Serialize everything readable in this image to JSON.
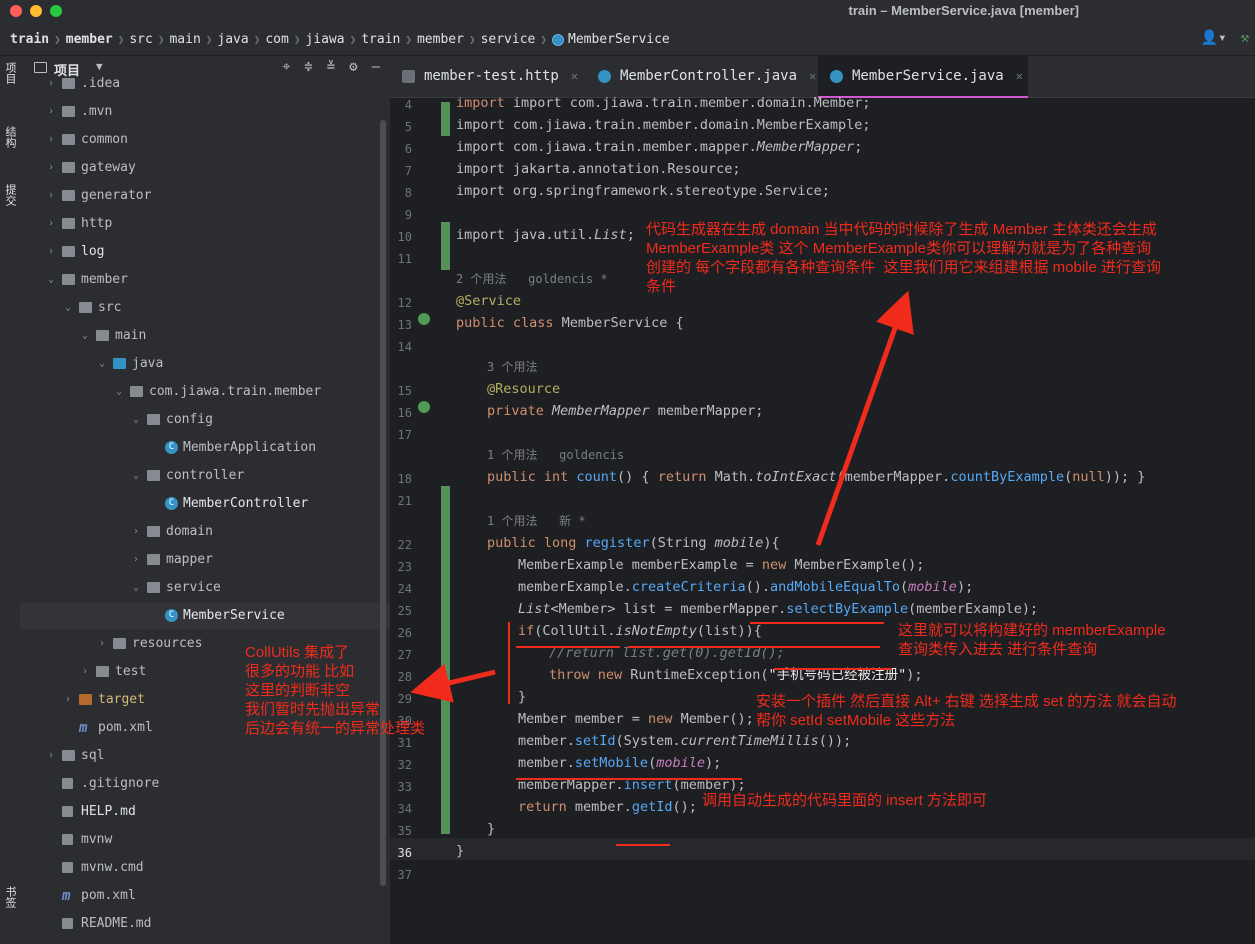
{
  "window": {
    "title": "train – MemberService.java [member]"
  },
  "breadcrumbs": [
    "train",
    "member",
    "src",
    "main",
    "java",
    "com",
    "jiawa",
    "train",
    "member",
    "service",
    "MemberService"
  ],
  "toolbar": {
    "user_icon": "user-icon",
    "hammer_icon": "hammer-icon"
  },
  "left_strip": {
    "items": [
      "项目",
      "结构",
      "提交",
      "书签"
    ]
  },
  "project": {
    "title": "项目",
    "tools": [
      "target-icon",
      "expand-icon",
      "collapse-icon",
      "gear-icon",
      "minimize-icon"
    ],
    "tree": [
      ".idea",
      ".mvn",
      "common",
      "gateway",
      "generator",
      "http",
      "log",
      "member",
      "src",
      "main",
      "java",
      "com.jiawa.train.member",
      "config",
      "MemberApplication",
      "controller",
      "MemberController",
      "domain",
      "mapper",
      "service",
      "MemberService",
      "resources",
      "test",
      "target",
      "pom.xml",
      "sql",
      ".gitignore",
      "HELP.md",
      "mvnw",
      "mvnw.cmd",
      "pom.xml",
      "README.md"
    ]
  },
  "tabs": [
    {
      "label": "member-test.http"
    },
    {
      "label": "MemberController.java"
    },
    {
      "label": "MemberService.java"
    }
  ],
  "line_numbers": [
    "4",
    "5",
    "6",
    "7",
    "8",
    "9",
    "10",
    "11",
    "12",
    "13",
    "14",
    "15",
    "16",
    "17",
    "18",
    "21",
    "22",
    "23",
    "24",
    "25",
    "26",
    "27",
    "28",
    "29",
    "30",
    "31",
    "32",
    "33",
    "34",
    "35",
    "36",
    "37"
  ],
  "code": {
    "l4": "import com.jiawa.train.member.domain.Member;",
    "l5": "import com.jiawa.train.member.domain.MemberExample;",
    "l6a": "import com.jiawa.train.member.mapper.",
    "l6b": "MemberMapper",
    "l6c": ";",
    "l7": "import jakarta.annotation.Resource;",
    "l8": "import org.springframework.stereotype.Service;",
    "l10a": "import java.util.",
    "l10b": "List",
    "l10c": ";",
    "h1": "2 个用法   goldencis *",
    "l12": "@Service",
    "l13a": "public class ",
    "l13b": "MemberService ",
    "l13c": "{",
    "h2": "3 个用法",
    "l15": "@Resource",
    "l16a": "private ",
    "l16b": "MemberMapper",
    "l16c": " memberMapper;",
    "h3": "1 个用法   goldencis",
    "l18a": "public int ",
    "l18b": "count",
    "l18c": "() { ",
    "l18d": "return ",
    "l18e": "Math.",
    "l18f": "toIntExact",
    "l18g": "(memberMapper.",
    "l18h": "countByExample",
    "l18i": "(",
    "l18j": "null",
    "l18k": ")); }",
    "h4": "1 个用法   新 *",
    "l22a": "public long ",
    "l22b": "register",
    "l22c": "(String ",
    "l22d": "mobile",
    "l22e": "){",
    "l23a": "MemberExample memberExample = ",
    "l23b": "new ",
    "l23c": "MemberExample",
    "l23d": "();",
    "l24a": "memberExample.",
    "l24b": "createCriteria",
    "l24c": "().",
    "l24d": "andMobileEqualTo",
    "l24e": "(",
    "l24f": "mobile",
    "l24g": ");",
    "l25a": "List",
    "l25b": "<Member> list = memberMapper.",
    "l25c": "selectByExample",
    "l25d": "(memberExample);",
    "l26a": "if",
    "l26b": "(CollUtil.",
    "l26c": "isNotEmpty",
    "l26d": "(list)){",
    "l27": "//return list.get(0).getId();",
    "l28a": "throw new ",
    "l28b": "RuntimeException",
    "l28c": "(",
    "l28d": "\"手机号码已经被注册\"",
    "l28e": ");",
    "l29": "}",
    "l30a": "Member member = ",
    "l30b": "new ",
    "l30c": "Member",
    "l30d": "();",
    "l31a": "member.",
    "l31b": "setId",
    "l31c": "(System.",
    "l31d": "currentTimeMillis",
    "l31e": "());",
    "l32a": "member.",
    "l32b": "setMobile",
    "l32c": "(",
    "l32d": "mobile",
    "l32e": ");",
    "l33a": "memberMapper.",
    "l33b": "insert",
    "l33c": "(member);",
    "l34a": "return ",
    "l34b": "member.",
    "l34c": "getId",
    "l34d": "();",
    "l35": "}",
    "l36": "}"
  },
  "annotations": {
    "n1": "代码生成器在生成 domain 当中代码的时候除了生成 Member 主体类还会生成\nMemberExample类 这个 MemberExample类你可以理解为就是为了各种查询\n创建的 每个字段都有各种查询条件  这里我们用它来组建根据 mobile 进行查询\n条件",
    "n2": "这里就可以将构建好的 memberExample\n查询类传入进去 进行条件查询",
    "n3": "CollUtils 集成了\n很多的功能 比如\n这里的判断非空\n我们暂时先抛出异常\n后边会有统一的异常处理类",
    "n4": "安装一个插件 然后直接 Alt+ 右键 选择生成 set 的方法 就会自动\n帮你 setId setMobile 这些方法",
    "n5": "调用自动生成的代码里面的 insert 方法即可",
    "color": "#f02b1c"
  }
}
